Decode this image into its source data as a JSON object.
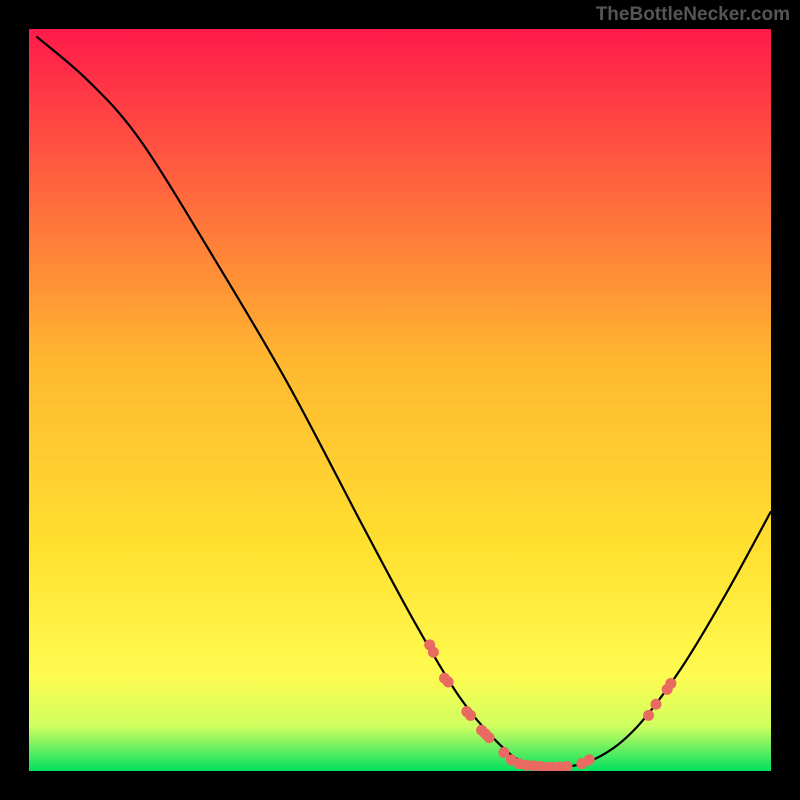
{
  "watermark": "TheBottleNecker.com",
  "chart_data": {
    "type": "line",
    "title": "",
    "xlabel": "",
    "ylabel": "",
    "xlim": [
      0,
      100
    ],
    "ylim": [
      0,
      100
    ],
    "grid": false,
    "background_gradient": {
      "stops": [
        {
          "offset": 0,
          "color": "#ff1a4a"
        },
        {
          "offset": 45,
          "color": "#ffb830"
        },
        {
          "offset": 70,
          "color": "#ffe030"
        },
        {
          "offset": 87,
          "color": "#fffb50"
        },
        {
          "offset": 94,
          "color": "#d0ff60"
        },
        {
          "offset": 100,
          "color": "#00e060"
        }
      ]
    },
    "curve": {
      "description": "V-shaped bottleneck curve: steep descent from top-left to a minimum near x≈70, then shallower rise to right edge",
      "points": [
        {
          "x": 1,
          "y": 99
        },
        {
          "x": 8,
          "y": 93
        },
        {
          "x": 15,
          "y": 85
        },
        {
          "x": 25,
          "y": 69
        },
        {
          "x": 35,
          "y": 52
        },
        {
          "x": 45,
          "y": 33
        },
        {
          "x": 52,
          "y": 20
        },
        {
          "x": 58,
          "y": 10
        },
        {
          "x": 63,
          "y": 4
        },
        {
          "x": 67,
          "y": 1
        },
        {
          "x": 72,
          "y": 0.5
        },
        {
          "x": 77,
          "y": 2
        },
        {
          "x": 82,
          "y": 6
        },
        {
          "x": 88,
          "y": 14
        },
        {
          "x": 94,
          "y": 24
        },
        {
          "x": 100,
          "y": 35
        }
      ]
    },
    "marker_color": "#e86a60",
    "markers": [
      {
        "x": 54.0,
        "y": 17.0
      },
      {
        "x": 54.5,
        "y": 16.0
      },
      {
        "x": 56.0,
        "y": 12.5
      },
      {
        "x": 56.5,
        "y": 12.0
      },
      {
        "x": 59.0,
        "y": 8.0
      },
      {
        "x": 59.5,
        "y": 7.5
      },
      {
        "x": 61.0,
        "y": 5.5
      },
      {
        "x": 61.5,
        "y": 5.0
      },
      {
        "x": 62.0,
        "y": 4.5
      },
      {
        "x": 64.0,
        "y": 2.5
      },
      {
        "x": 65.0,
        "y": 1.5
      },
      {
        "x": 66.0,
        "y": 1.0
      },
      {
        "x": 67.0,
        "y": 0.8
      },
      {
        "x": 68.0,
        "y": 0.7
      },
      {
        "x": 69.0,
        "y": 0.6
      },
      {
        "x": 70.0,
        "y": 0.5
      },
      {
        "x": 70.5,
        "y": 0.5
      },
      {
        "x": 71.5,
        "y": 0.55
      },
      {
        "x": 72.5,
        "y": 0.6
      },
      {
        "x": 74.5,
        "y": 1.0
      },
      {
        "x": 75.5,
        "y": 1.5
      },
      {
        "x": 83.5,
        "y": 7.5
      },
      {
        "x": 84.5,
        "y": 9.0
      },
      {
        "x": 86.0,
        "y": 11.0
      },
      {
        "x": 86.5,
        "y": 11.8
      }
    ]
  }
}
